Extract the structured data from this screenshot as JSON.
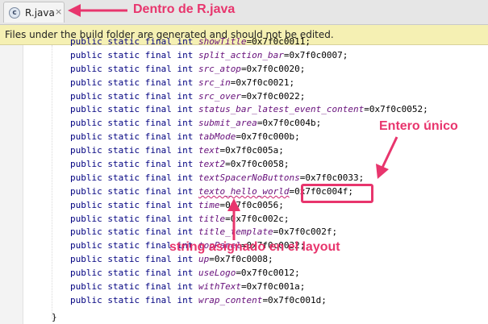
{
  "tab": {
    "label": "R.java",
    "close": "×",
    "icon_glyph": "c"
  },
  "banner": {
    "text": "Files under the build folder are generated and should not be edited."
  },
  "code": {
    "prefix": "public static final int",
    "lines": [
      {
        "name": "showTitle",
        "value": "=0x7f0c0011;"
      },
      {
        "name": "split_action_bar",
        "value": "=0x7f0c0007;"
      },
      {
        "name": "src_atop",
        "value": "=0x7f0c0020;"
      },
      {
        "name": "src_in",
        "value": "=0x7f0c0021;"
      },
      {
        "name": "src_over",
        "value": "=0x7f0c0022;"
      },
      {
        "name": "status_bar_latest_event_content",
        "value": "=0x7f0c0052;"
      },
      {
        "name": "submit_area",
        "value": "=0x7f0c004b;"
      },
      {
        "name": "tabMode",
        "value": "=0x7f0c000b;"
      },
      {
        "name": "text",
        "value": "=0x7f0c005a;"
      },
      {
        "name": "text2",
        "value": "=0x7f0c0058;"
      },
      {
        "name": "textSpacerNoButtons",
        "value": "=0x7f0c0033;"
      },
      {
        "name": "texto_hello_world",
        "value": "=0x7f0c004f;"
      },
      {
        "name": "time",
        "value": "=0x7f0c0056;"
      },
      {
        "name": "title",
        "value": "=0x7f0c002c;"
      },
      {
        "name": "title_template",
        "value": "=0x7f0c002f;"
      },
      {
        "name": "topPanel",
        "value": "=0x7f0c0032;"
      },
      {
        "name": "up",
        "value": "=0x7f0c0008;"
      },
      {
        "name": "useLogo",
        "value": "=0x7f0c0012;"
      },
      {
        "name": "withText",
        "value": "=0x7f0c001a;"
      },
      {
        "name": "wrap_content",
        "value": "=0x7f0c001d;"
      }
    ],
    "closing_brace": "}"
  },
  "annotations": {
    "inside_file": "Dentro de R.java",
    "unique_int": "Entero único",
    "layout_string": "string asignado en el layout"
  },
  "colors": {
    "accent": "#e8356d",
    "banner_bg": "#f5f0b3"
  }
}
